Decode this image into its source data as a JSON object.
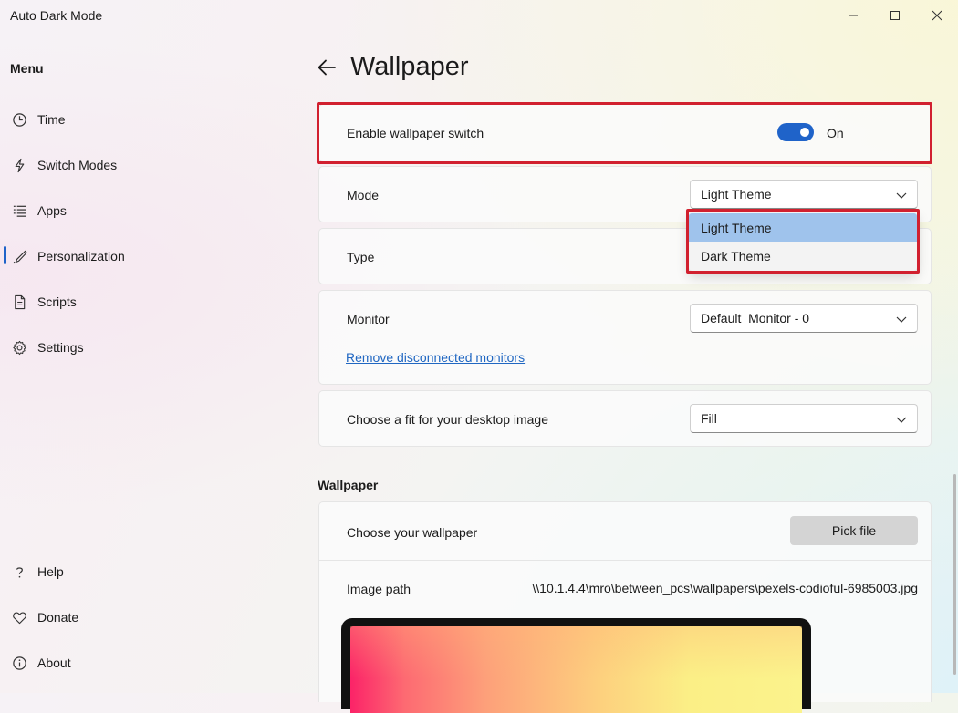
{
  "app": {
    "title": "Auto Dark Mode",
    "window_controls": [
      "minimize-icon",
      "maximize-icon",
      "close-icon"
    ]
  },
  "sidebar": {
    "heading": "Menu",
    "items": [
      {
        "label": "Time",
        "icon": "clock-icon"
      },
      {
        "label": "Switch Modes",
        "icon": "lightning-icon"
      },
      {
        "label": "Apps",
        "icon": "list-icon"
      },
      {
        "label": "Personalization",
        "icon": "brush-icon",
        "selected": true
      },
      {
        "label": "Scripts",
        "icon": "document-icon"
      },
      {
        "label": "Settings",
        "icon": "gear-icon"
      }
    ],
    "footer_items": [
      {
        "label": "Help",
        "icon": "question-icon"
      },
      {
        "label": "Donate",
        "icon": "heart-icon"
      },
      {
        "label": "About",
        "icon": "info-icon"
      }
    ]
  },
  "header": {
    "title": "Wallpaper"
  },
  "settings": {
    "enable": {
      "label": "Enable wallpaper switch",
      "state_text": "On",
      "on": true
    },
    "mode": {
      "label": "Mode",
      "value": "Light Theme",
      "options": [
        "Light Theme",
        "Dark Theme"
      ],
      "selected_option": "Light Theme"
    },
    "type": {
      "label": "Type"
    },
    "monitor": {
      "label": "Monitor",
      "value": "Default_Monitor - 0",
      "link": "Remove disconnected monitors"
    },
    "fit": {
      "label": "Choose a fit for your desktop image",
      "value": "Fill"
    }
  },
  "wallpaper": {
    "section_title": "Wallpaper",
    "choose_label": "Choose your wallpaper",
    "pick_button": "Pick file",
    "path_label": "Image path",
    "path_value": "\\\\10.1.4.4\\mro\\between_pcs\\wallpapers\\pexels-codioful-6985003.jpg"
  },
  "colors": {
    "accent": "#1f63c9",
    "highlight_box": "#d1202f",
    "selected_option_bg": "#9fc3ec",
    "link": "#2067c2"
  }
}
